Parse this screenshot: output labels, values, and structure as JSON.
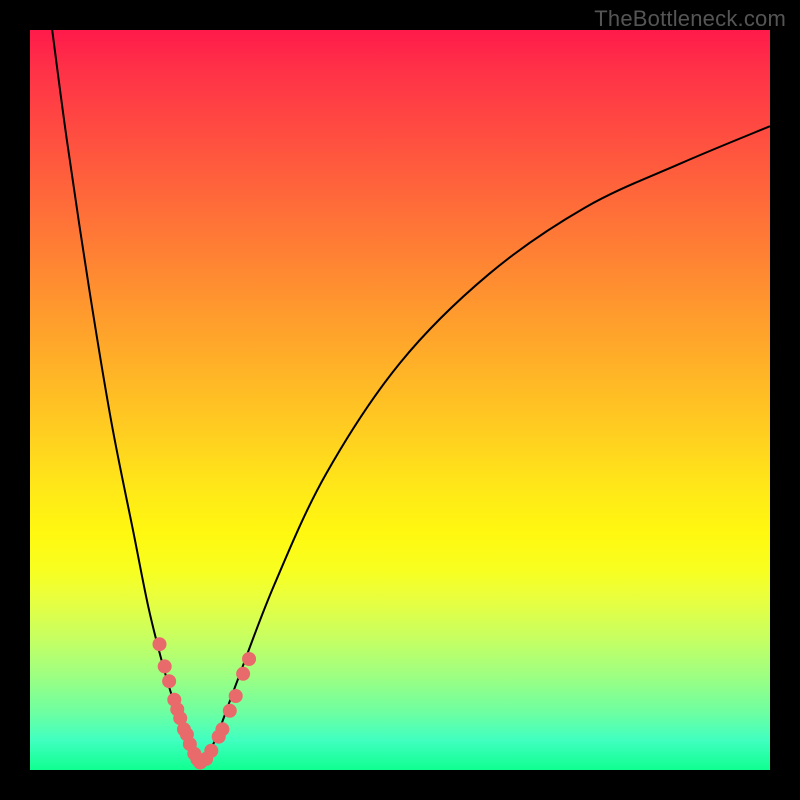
{
  "watermark": "TheBottleneck.com",
  "chart_data": {
    "type": "line",
    "title": "",
    "xlabel": "",
    "ylabel": "",
    "xlim": [
      0,
      100
    ],
    "ylim": [
      0,
      100
    ],
    "grid": false,
    "legend": false,
    "background_gradient": {
      "top": "#ff1a4a",
      "mid": "#fff810",
      "bottom": "#10ff90"
    },
    "series": [
      {
        "name": "left-branch",
        "x": [
          3,
          5,
          8,
          11,
          14,
          16,
          18,
          19.5,
          21,
          22,
          23
        ],
        "values": [
          100,
          85,
          65,
          47,
          32,
          22,
          14,
          9,
          5,
          2.5,
          0.5
        ]
      },
      {
        "name": "right-branch",
        "x": [
          23,
          25,
          28,
          33,
          40,
          50,
          62,
          75,
          88,
          100
        ],
        "values": [
          0.5,
          4,
          12,
          25,
          40,
          55,
          67,
          76,
          82,
          87
        ]
      }
    ],
    "markers": [
      {
        "series": "left-branch",
        "x": 17.5,
        "y": 17
      },
      {
        "series": "left-branch",
        "x": 18.2,
        "y": 14
      },
      {
        "series": "left-branch",
        "x": 18.8,
        "y": 12
      },
      {
        "series": "left-branch",
        "x": 19.5,
        "y": 9.5
      },
      {
        "series": "left-branch",
        "x": 19.9,
        "y": 8.2
      },
      {
        "series": "left-branch",
        "x": 20.3,
        "y": 7
      },
      {
        "series": "left-branch",
        "x": 20.8,
        "y": 5.5
      },
      {
        "series": "left-branch",
        "x": 21.2,
        "y": 4.8
      },
      {
        "series": "left-branch",
        "x": 21.6,
        "y": 3.5
      },
      {
        "series": "left-branch",
        "x": 22.2,
        "y": 2.2
      },
      {
        "series": "left-branch",
        "x": 22.6,
        "y": 1.5
      },
      {
        "series": "left-branch",
        "x": 23,
        "y": 1
      },
      {
        "series": "right-branch",
        "x": 23.8,
        "y": 1.5
      },
      {
        "series": "right-branch",
        "x": 24.5,
        "y": 2.6
      },
      {
        "series": "right-branch",
        "x": 25.5,
        "y": 4.5
      },
      {
        "series": "right-branch",
        "x": 26,
        "y": 5.5
      },
      {
        "series": "right-branch",
        "x": 27,
        "y": 8
      },
      {
        "series": "right-branch",
        "x": 27.8,
        "y": 10
      },
      {
        "series": "right-branch",
        "x": 28.8,
        "y": 13
      },
      {
        "series": "right-branch",
        "x": 29.6,
        "y": 15
      }
    ],
    "marker_color": "#e96a6a",
    "marker_radius": 7
  }
}
